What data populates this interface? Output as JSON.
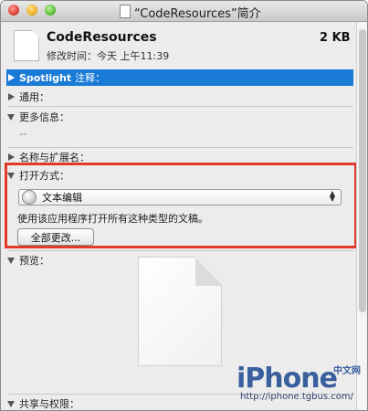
{
  "window": {
    "title": "“CodeResources”简介"
  },
  "file": {
    "name": "CodeResources",
    "size": "2 KB",
    "modified": "修改时间：今天 上午11:39"
  },
  "sections": {
    "spotlight": {
      "label": "Spotlight",
      "suffix": "注释："
    },
    "general": "通用：",
    "more_info": "更多信息：",
    "more_info_value": "--",
    "name_ext": "名称与扩展名：",
    "open_with": "打开方式：",
    "preview": "预览：",
    "sharing": "共享与权限："
  },
  "open_with": {
    "selected_app": "文本编辑",
    "hint": "使用该应用程序打开所有这种类型的文稿。",
    "change_all_label": "全部更改..."
  },
  "watermark": {
    "brand": "iPhone",
    "cn": "中文网",
    "url": "http://iphone.tgbus.com/"
  },
  "colors": {
    "selection_blue": "#1a7bd6",
    "highlight_red": "#e23a2a"
  },
  "icons": [
    "document-icon",
    "text-edit-app-icon",
    "disclosure-triangle-icon"
  ]
}
